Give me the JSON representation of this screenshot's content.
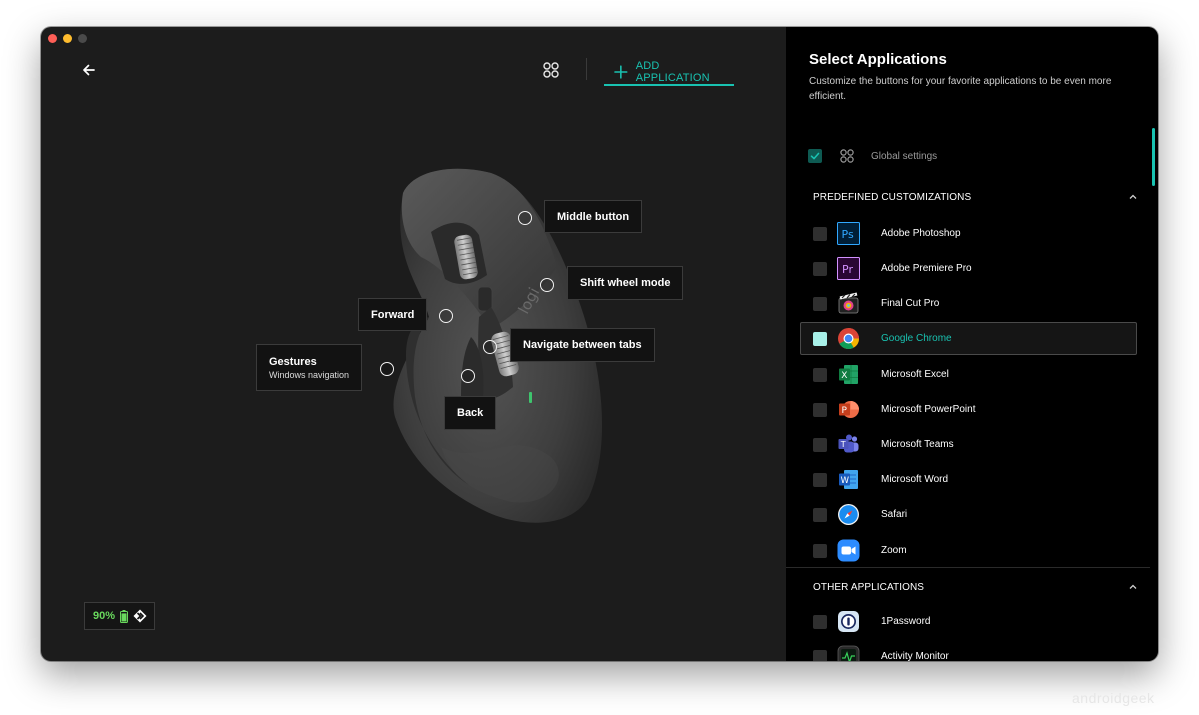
{
  "toolbar": {
    "add_application_label": "ADD APPLICATION"
  },
  "mouse_callouts": {
    "middle_button": "Middle button",
    "shift_wheel_mode": "Shift wheel mode",
    "forward": "Forward",
    "navigate_between_tabs": "Navigate between tabs",
    "gestures_title": "Gestures",
    "gestures_sub": "Windows navigation",
    "back": "Back",
    "mouse_brand": "logi"
  },
  "battery": {
    "percent": "90%",
    "level": 0.9,
    "color": "#69d95d"
  },
  "panel": {
    "title": "Select Applications",
    "description": "Customize the buttons for your favorite applications to be even more efficient.",
    "global_settings": {
      "label": "Global settings",
      "checked": true
    },
    "predefined_header": "PREDEFINED CUSTOMIZATIONS",
    "other_header": "OTHER APPLICATIONS",
    "predefined_apps": [
      {
        "label": "Adobe Photoshop",
        "icon": "photoshop-icon",
        "checked": false
      },
      {
        "label": "Adobe Premiere Pro",
        "icon": "premiere-pro-icon",
        "checked": false
      },
      {
        "label": "Final Cut Pro",
        "icon": "final-cut-pro-icon",
        "checked": false
      },
      {
        "label": "Google Chrome",
        "icon": "chrome-icon",
        "checked": false,
        "selected": true
      },
      {
        "label": "Microsoft Excel",
        "icon": "excel-icon",
        "checked": false
      },
      {
        "label": "Microsoft PowerPoint",
        "icon": "powerpoint-icon",
        "checked": false
      },
      {
        "label": "Microsoft Teams",
        "icon": "teams-icon",
        "checked": false
      },
      {
        "label": "Microsoft Word",
        "icon": "word-icon",
        "checked": false
      },
      {
        "label": "Safari",
        "icon": "safari-icon",
        "checked": false
      },
      {
        "label": "Zoom",
        "icon": "zoom-icon",
        "checked": false
      }
    ],
    "other_apps": [
      {
        "label": "1Password",
        "icon": "1password-icon",
        "checked": false
      },
      {
        "label": "Activity Monitor",
        "icon": "activity-monitor-icon",
        "checked": false
      }
    ]
  },
  "colors": {
    "accent": "#19c2b1",
    "window_bg": "#1c1c1c",
    "panel_bg": "#000000"
  },
  "watermark": "androidgeek"
}
